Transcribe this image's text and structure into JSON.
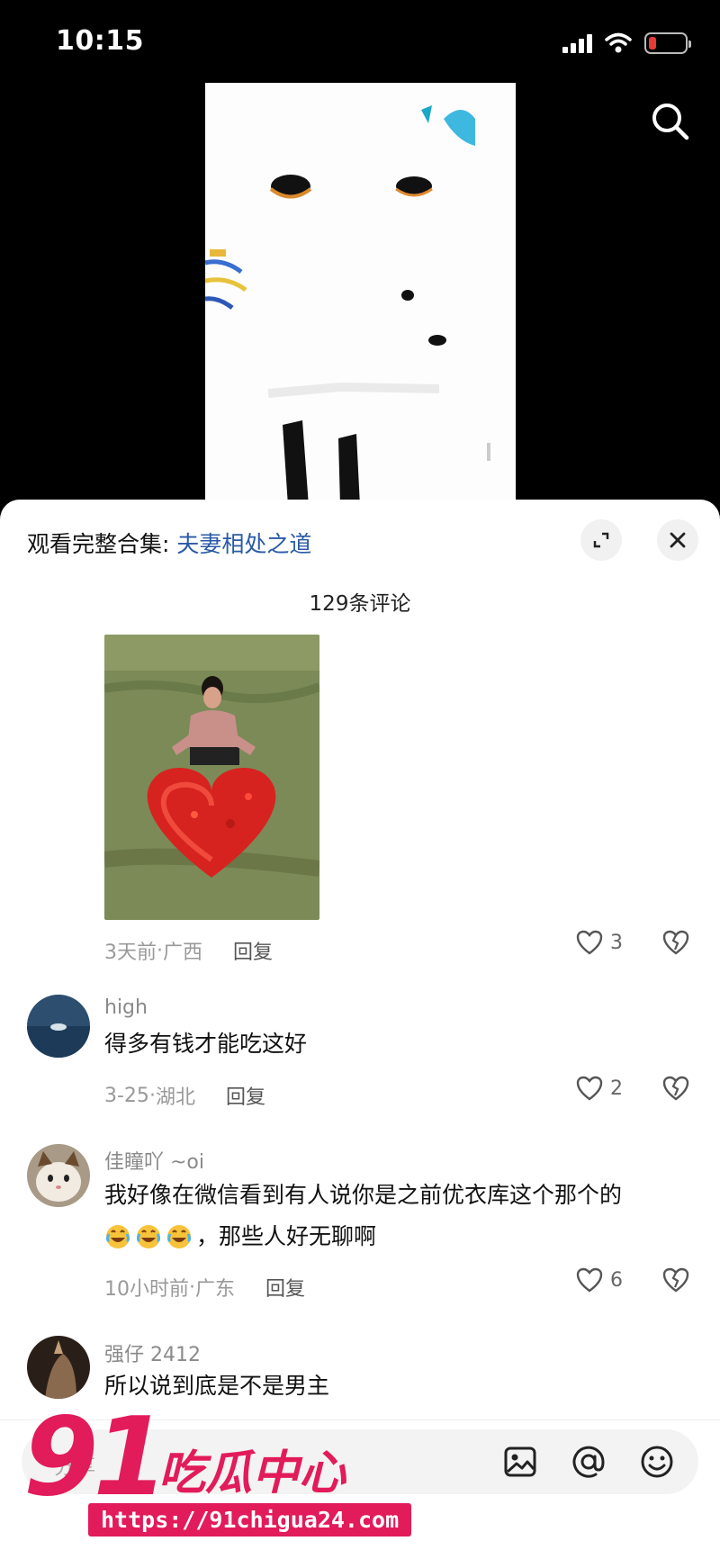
{
  "status_bar": {
    "time": "10:15",
    "battery_color": "#e53935"
  },
  "sheet": {
    "header_prefix": "观看完整合集:",
    "collection_name": "夫妻相处之道",
    "comment_count": "129条评论"
  },
  "comments": [
    {
      "time": "3天前",
      "location": "广西",
      "reply": "回复",
      "likes": "3"
    },
    {
      "username": "high",
      "text": "得多有钱才能吃这好",
      "time": "3-25",
      "location": "湖北",
      "reply": "回复",
      "likes": "2"
    },
    {
      "username": "佳瞳吖 ~oi",
      "text": "我好像在微信看到有人说你是之前优衣库这个那个的",
      "text2": "，那些人好无聊啊",
      "time": "10小时前",
      "location": "广东",
      "reply": "回复",
      "likes": "6"
    },
    {
      "username": "强仔 2412",
      "text": "所以说到底是不是男主"
    }
  ],
  "input": {
    "placeholder": "分享"
  },
  "watermark": {
    "number": "91",
    "text": "吃瓜中心",
    "url": "https://91chigua24.com"
  },
  "icons": [
    "search-icon",
    "expand-icon",
    "close-icon",
    "heart-icon",
    "broken-heart-icon",
    "image-icon",
    "at-icon",
    "emoji-icon"
  ]
}
